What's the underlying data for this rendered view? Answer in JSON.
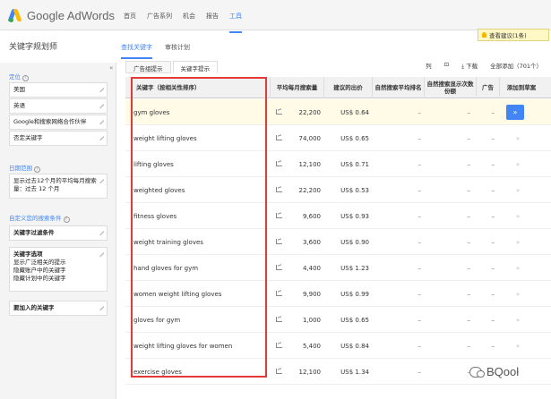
{
  "header": {
    "logo_text": "Google AdWords",
    "nav": [
      "首页",
      "广告系列",
      "机会",
      "报告",
      "工具"
    ]
  },
  "page": {
    "title": "关键字规划师",
    "subtabs": [
      "查找关键字",
      "审核计划"
    ],
    "notify": "查看建议(1条)"
  },
  "sidebar": {
    "collapse": "«",
    "section_targeting": "定位",
    "targeting_items": [
      "美国",
      "英语",
      "Google和搜索网络合作伙伴",
      "否定关键字"
    ],
    "section_date": "日期范围",
    "date_text": "显示过去12个月的平均每月搜索量：过去 12 个月",
    "section_filter": "自定义您的搜索条件",
    "filter_label": "关键字过滤条件",
    "options_label": "关键字选项",
    "options_lines": [
      "显示广泛相关的提示",
      "隐藏账户中的关键字",
      "隐藏计划中的关键字"
    ],
    "include_label": "要加入的关键字"
  },
  "table": {
    "tabs": [
      "广告组提示",
      "关键字提示"
    ],
    "toolbar": [
      "列",
      "⊡",
      "⤓ 下载",
      "全部添加（701个）"
    ],
    "headers": [
      "关键字（按相关性排序）",
      "平均每月搜索量",
      "建议的出价",
      "自然搜索平均排名",
      "自然搜索显示次数份额",
      "广告",
      "添加到草案"
    ],
    "rows": [
      {
        "keyword": "gym gloves",
        "volume": "22,200",
        "price": "US$ 0.64",
        "d1": "–",
        "d2": "–",
        "d3": "–"
      },
      {
        "keyword": "weight lifting gloves",
        "volume": "74,000",
        "price": "US$ 0.65",
        "d1": "–",
        "d2": "–",
        "d3": "–"
      },
      {
        "keyword": "lifting gloves",
        "volume": "12,100",
        "price": "US$ 0.71",
        "d1": "–",
        "d2": "–",
        "d3": "–"
      },
      {
        "keyword": "weighted gloves",
        "volume": "22,200",
        "price": "US$ 0.53",
        "d1": "–",
        "d2": "–",
        "d3": "–"
      },
      {
        "keyword": "fitness gloves",
        "volume": "9,600",
        "price": "US$ 0.93",
        "d1": "–",
        "d2": "–",
        "d3": "–"
      },
      {
        "keyword": "weight training gloves",
        "volume": "3,600",
        "price": "US$ 0.90",
        "d1": "–",
        "d2": "–",
        "d3": "–"
      },
      {
        "keyword": "hand gloves for gym",
        "volume": "4,400",
        "price": "US$ 1.23",
        "d1": "–",
        "d2": "–",
        "d3": "–"
      },
      {
        "keyword": "women weight lifting gloves",
        "volume": "9,900",
        "price": "US$ 0.99",
        "d1": "–",
        "d2": "–",
        "d3": "–"
      },
      {
        "keyword": "gloves for gym",
        "volume": "1,000",
        "price": "US$ 0.65",
        "d1": "–",
        "d2": "–",
        "d3": "–"
      },
      {
        "keyword": "weight lifting gloves for women",
        "volume": "5,400",
        "price": "US$ 0.84",
        "d1": "–",
        "d2": "–",
        "d3": "–"
      },
      {
        "keyword": "exercise gloves",
        "volume": "12,100",
        "price": "US$ 1.34",
        "d1": "–",
        "d2": "–",
        "d3": "–"
      }
    ],
    "add_first": "»",
    "add_other": "»"
  },
  "watermark": "BQool",
  "colors": {
    "accent": "#4285f4",
    "highlight": "#e53935"
  }
}
